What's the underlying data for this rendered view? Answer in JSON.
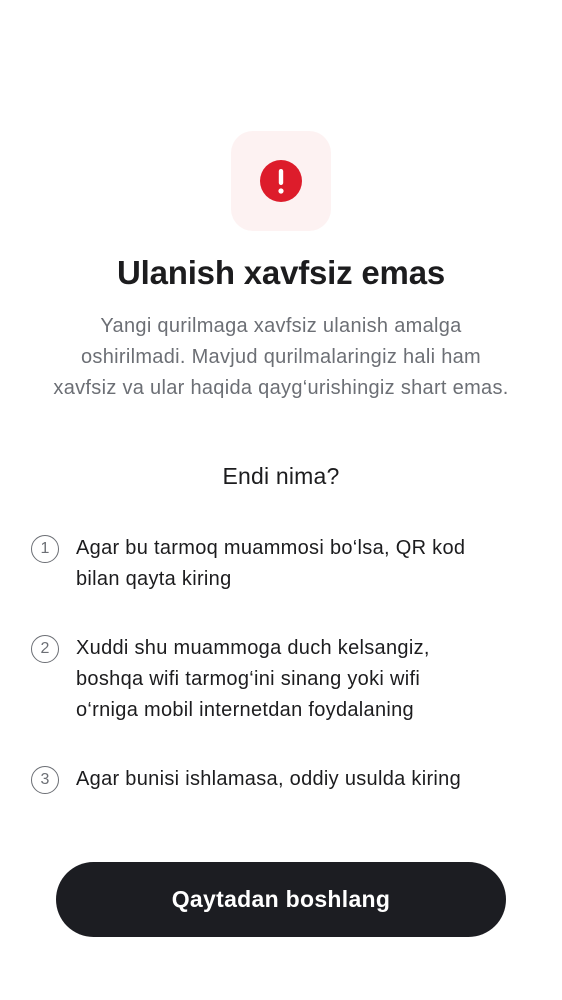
{
  "icon": {
    "name": "alert-circle-icon",
    "color": "#dd1c2b",
    "background": "#fdf2f2"
  },
  "title": "Ulanish xavfsiz emas",
  "subtitle_lines": [
    "Yangi qurilmaga xavfsiz ulanish amalga",
    "oshirilmadi. Mavjud qurilmalaringiz hali ham",
    "xavfsiz va ular haqida qayg‘urishingiz shart emas."
  ],
  "section_heading": "Endi nima?",
  "steps": [
    {
      "number": "1",
      "lines": [
        "Agar bu tarmoq muammosi bo‘lsa, QR kod",
        "bilan qayta kiring"
      ]
    },
    {
      "number": "2",
      "lines": [
        "Xuddi shu muammoga duch kelsangiz,",
        "boshqa wifi tarmog‘ini sinang yoki wifi",
        "o‘rniga mobil internetdan foydalaning"
      ]
    },
    {
      "number": "3",
      "lines": [
        "Agar bunisi ishlamasa, oddiy usulda kiring"
      ]
    }
  ],
  "primary_button": {
    "label": "Qaytadan boshlang",
    "color": "#1c1d22"
  }
}
